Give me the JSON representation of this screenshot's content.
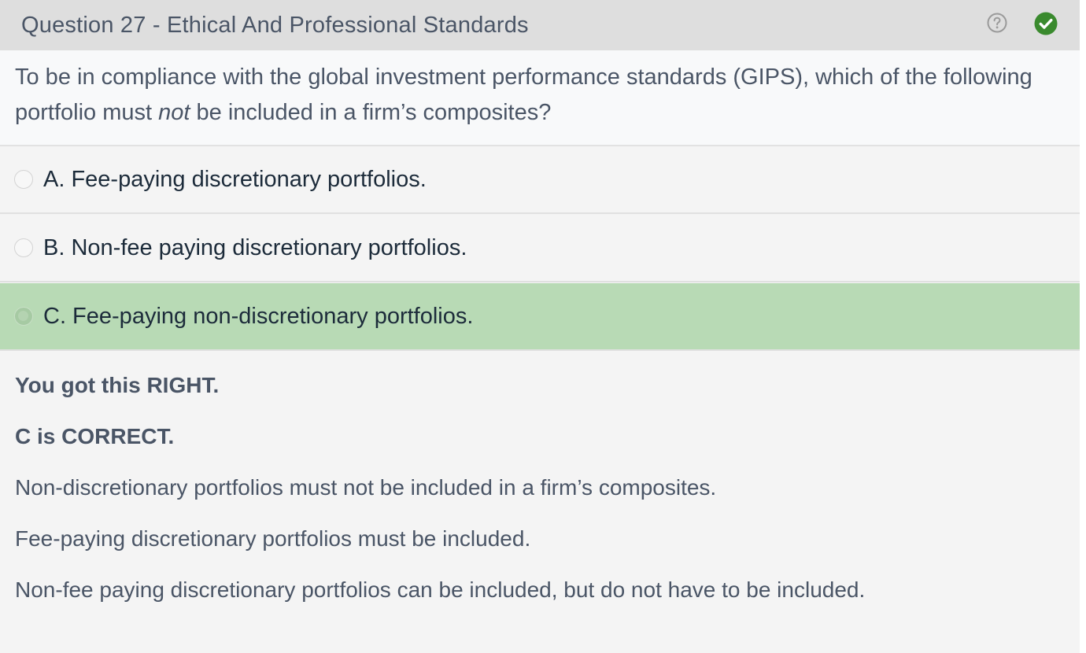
{
  "header": {
    "title": "Question 27 - Ethical And Professional Standards",
    "help_icon": "help-circle-icon",
    "status_icon": "check-circle-icon",
    "status_color": "#3a8a2e"
  },
  "question": {
    "text_before": "To be in compliance with the global investment performance standards (GIPS), which of the following portfolio must ",
    "emphasis": "not",
    "text_after": " be included in a firm’s composites?"
  },
  "options": [
    {
      "label": "A. Fee-paying discretionary portfolios.",
      "state": "unselected"
    },
    {
      "label": "B. Non-fee paying discretionary portfolios.",
      "state": "unselected"
    },
    {
      "label": "C. Fee-paying non-discretionary portfolios.",
      "state": "correct"
    }
  ],
  "feedback": {
    "result": "You got this RIGHT.",
    "correct_answer": "C is CORRECT.",
    "explanations": [
      "Non-discretionary portfolios must not be included in a firm’s composites.",
      "Fee-paying discretionary portfolios must be included.",
      "Non-fee paying discretionary portfolios can be included, but do not have to be included."
    ]
  },
  "colors": {
    "header_bg": "#dedede",
    "correct_option_bg": "#b8dab5",
    "panel_bg": "#f4f4f4"
  }
}
